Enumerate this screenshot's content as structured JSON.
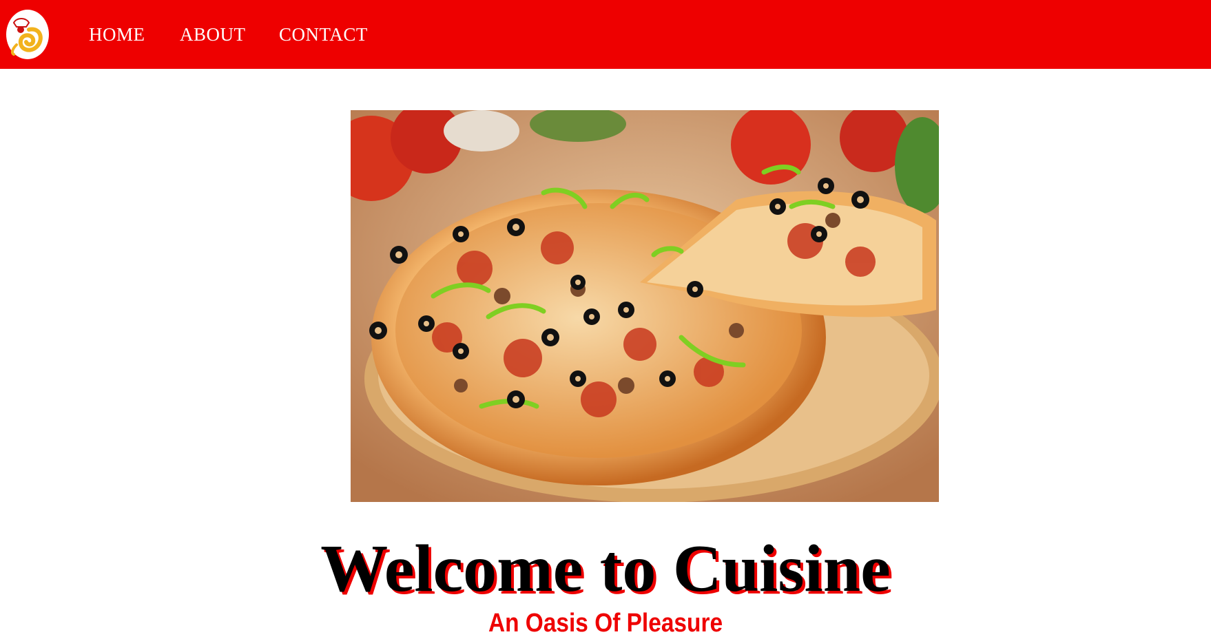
{
  "navbar": {
    "logo_icon": "chef-spoon-logo-icon",
    "background_color": "#ee0000",
    "links": [
      {
        "label": "HOME"
      },
      {
        "label": "ABOUT"
      },
      {
        "label": "CONTACT"
      }
    ]
  },
  "hero": {
    "image_subject": "pizza"
  },
  "content": {
    "title": "Welcome to Cuisine",
    "tagline": "An Oasis Of Pleasure",
    "title_shadow_color": "#ee0000",
    "tagline_color": "#ee0000"
  }
}
